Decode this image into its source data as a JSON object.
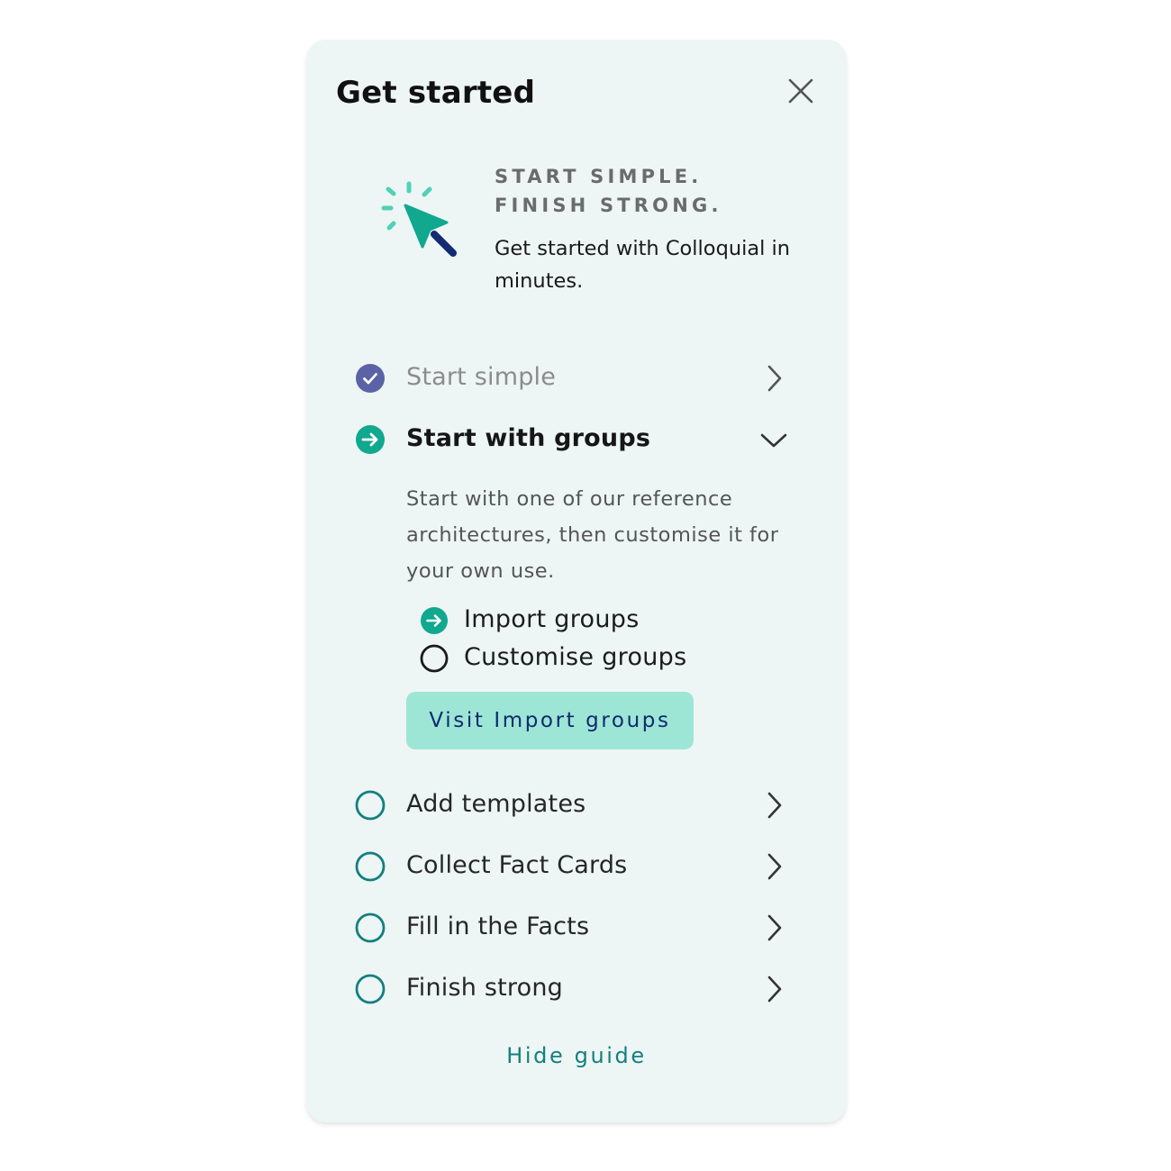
{
  "panel": {
    "title": "Get started",
    "close_icon": "close-icon"
  },
  "hero": {
    "icon": "cursor-click-icon",
    "tagline_line1": "START SIMPLE.",
    "tagline_line2": "FINISH STRONG.",
    "subtitle": "Get started with Colloquial in minutes."
  },
  "steps": [
    {
      "label": "Start simple",
      "status": "done",
      "icon": "check-circle-icon",
      "indicator": "chevron-right-icon"
    },
    {
      "label": "Start with groups",
      "status": "in-progress",
      "icon": "arrow-circle-icon",
      "indicator": "chevron-down-icon",
      "description": "Start with one of our reference architectures, then customise it for your own use.",
      "substeps": [
        {
          "label": "Import groups",
          "status": "in-progress",
          "icon": "arrow-circle-icon"
        },
        {
          "label": "Customise groups",
          "status": "todo",
          "icon": "empty-circle-icon"
        }
      ],
      "action_label": "Visit Import groups"
    },
    {
      "label": "Add templates",
      "status": "todo",
      "icon": "empty-circle-icon",
      "indicator": "chevron-right-icon"
    },
    {
      "label": "Collect Fact Cards",
      "status": "todo",
      "icon": "empty-circle-icon",
      "indicator": "chevron-right-icon"
    },
    {
      "label": "Fill in the Facts",
      "status": "todo",
      "icon": "empty-circle-icon",
      "indicator": "chevron-right-icon"
    },
    {
      "label": "Finish strong",
      "status": "todo",
      "icon": "empty-circle-icon",
      "indicator": "chevron-right-icon"
    }
  ],
  "footer": {
    "hide_label": "Hide guide"
  },
  "colors": {
    "panel_bg": "#edf6f4",
    "accent_teal": "#10a88f",
    "done_purple": "#5b63a6",
    "todo_ring": "#137f80",
    "button_bg": "#9de6d6",
    "button_text": "#0f2a6e",
    "link": "#137f80"
  }
}
